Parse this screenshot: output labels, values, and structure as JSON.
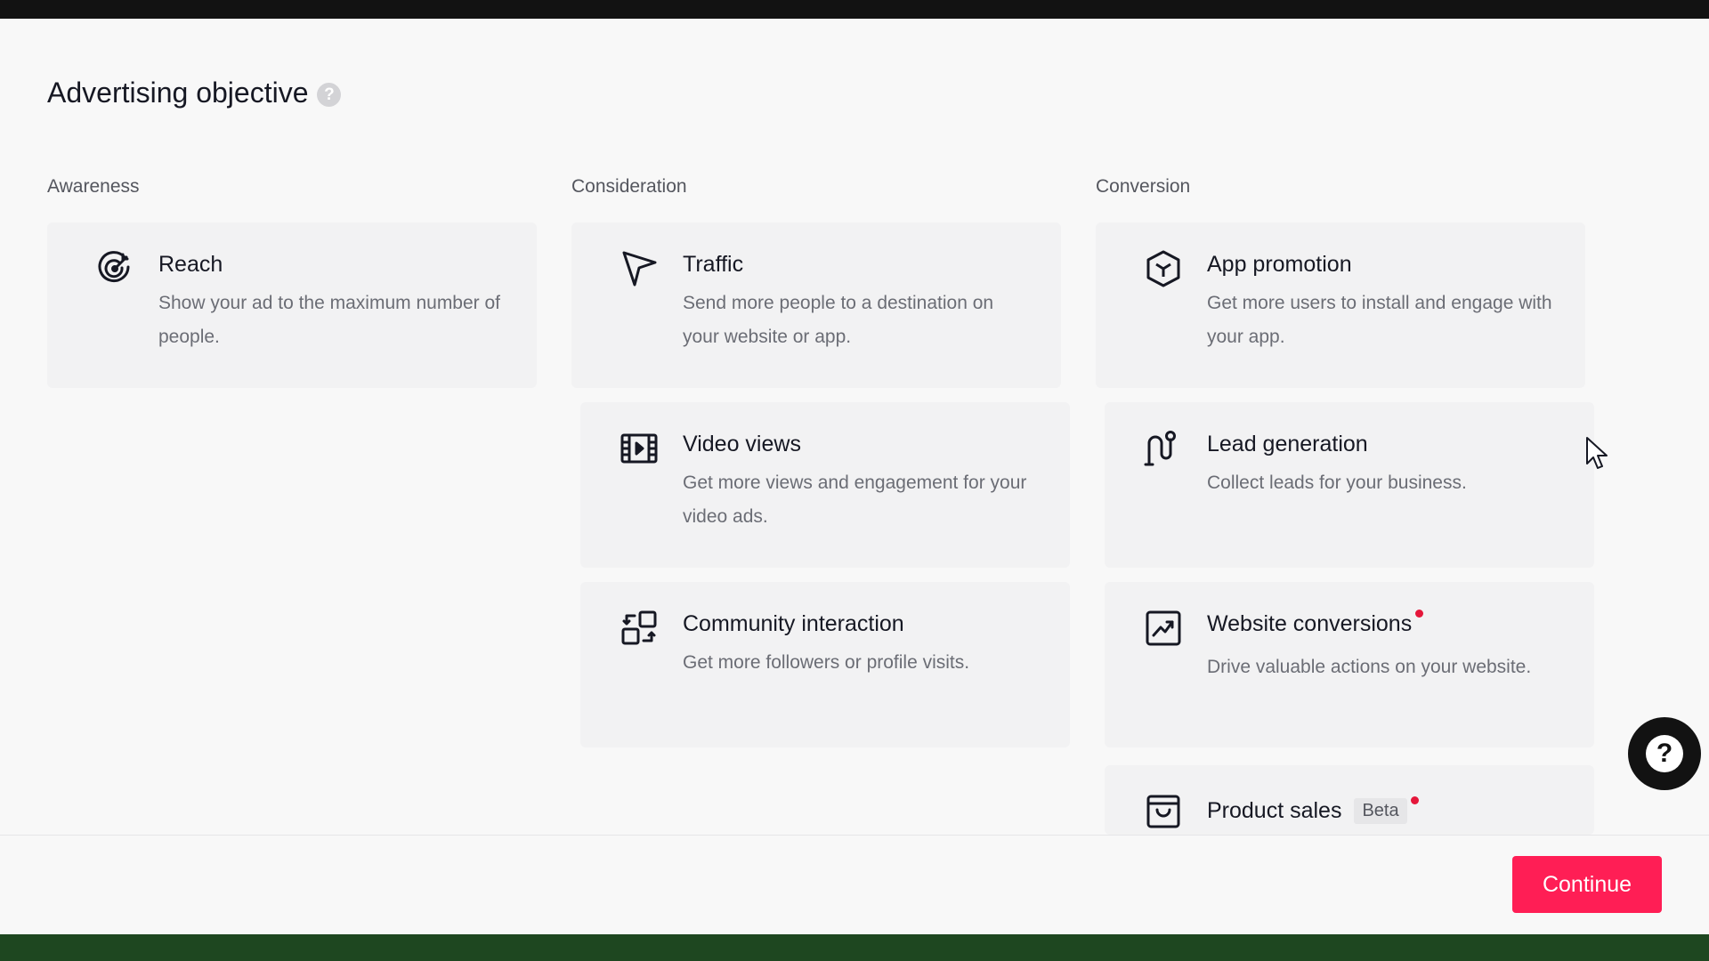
{
  "page": {
    "title": "Advertising objective",
    "help_glyph": "?"
  },
  "columns": [
    {
      "heading": "Awareness"
    },
    {
      "heading": "Consideration"
    },
    {
      "heading": "Conversion"
    }
  ],
  "cards": {
    "reach": {
      "title": "Reach",
      "description": "Show your ad to the maximum number of people.",
      "icon": "reach-target-icon"
    },
    "traffic": {
      "title": "Traffic",
      "description": "Send more people to a destination on your website or app.",
      "icon": "cursor-arrow-icon"
    },
    "video_views": {
      "title": "Video views",
      "description": "Get more views and engagement for your video ads.",
      "icon": "film-icon"
    },
    "community_interaction": {
      "title": "Community interaction",
      "description": "Get more followers or profile visits.",
      "icon": "swap-icon"
    },
    "app_promotion": {
      "title": "App promotion",
      "description": "Get more users to install and engage with your app.",
      "icon": "hexagon-box-icon"
    },
    "lead_generation": {
      "title": "Lead generation",
      "description": "Collect leads for your business.",
      "icon": "magnet-icon"
    },
    "website_conversions": {
      "title": "Website conversions",
      "description": "Drive valuable actions on your website.",
      "icon": "trend-chart-icon",
      "has_new_dot": true
    },
    "product_sales": {
      "title": "Product sales",
      "badge": "Beta",
      "icon": "shopping-bag-icon",
      "has_new_dot": true
    }
  },
  "footer": {
    "continue_label": "Continue"
  },
  "help_fab": {
    "glyph": "?"
  },
  "colors": {
    "accent": "#ff1e55",
    "new_dot": "#e5173a",
    "card_bg": "#f2f2f3",
    "page_bg": "#f8f8f8"
  }
}
